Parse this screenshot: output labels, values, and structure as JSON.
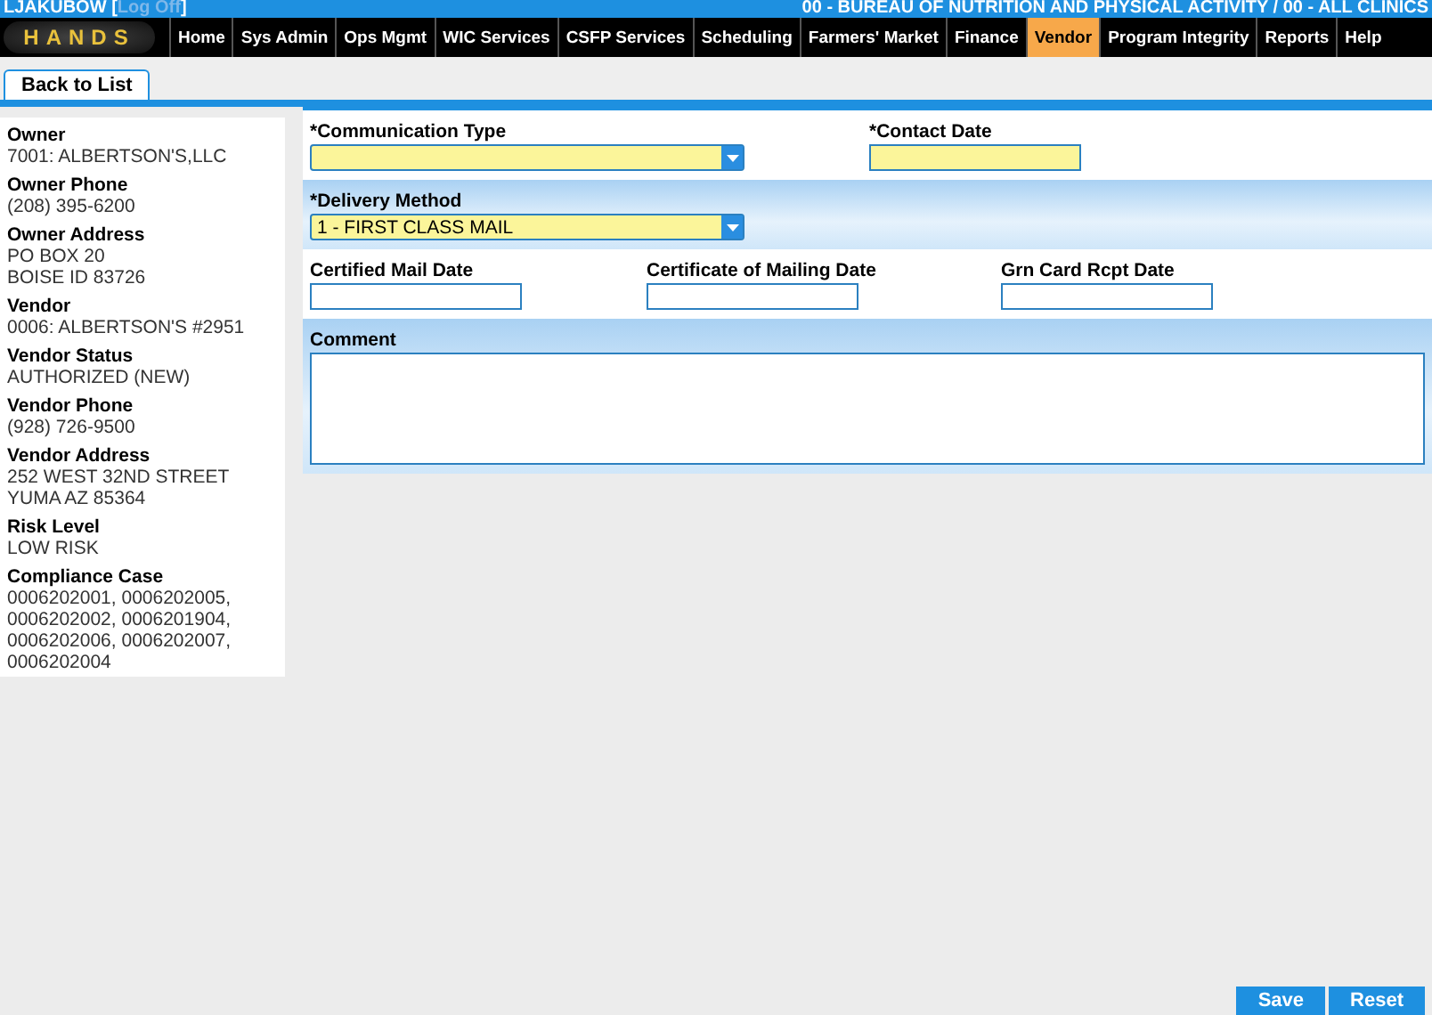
{
  "header": {
    "user": "LJAKUBOW",
    "open_bracket": "[",
    "log_off": "Log Off",
    "close_bracket": "]",
    "org": "00 - BUREAU OF NUTRITION AND PHYSICAL ACTIVITY / 00 - ALL CLINICS"
  },
  "logo": "HANDS",
  "menu": [
    {
      "label": "Home",
      "selected": false
    },
    {
      "label": "Sys Admin",
      "selected": false
    },
    {
      "label": "Ops Mgmt",
      "selected": false
    },
    {
      "label": "WIC Services",
      "selected": false
    },
    {
      "label": "CSFP Services",
      "selected": false
    },
    {
      "label": "Scheduling",
      "selected": false
    },
    {
      "label": "Farmers' Market",
      "selected": false
    },
    {
      "label": "Finance",
      "selected": false
    },
    {
      "label": "Vendor",
      "selected": true
    },
    {
      "label": "Program Integrity",
      "selected": false
    },
    {
      "label": "Reports",
      "selected": false
    },
    {
      "label": "Help",
      "selected": false
    }
  ],
  "tabs": [
    {
      "label": "Back to List",
      "selected": true
    }
  ],
  "sidebar": [
    {
      "label": "Owner",
      "lines": [
        "7001: ALBERTSON'S,LLC"
      ]
    },
    {
      "label": "Owner Phone",
      "lines": [
        "(208) 395-6200"
      ]
    },
    {
      "label": "Owner Address",
      "lines": [
        "PO BOX 20",
        "BOISE ID 83726"
      ]
    },
    {
      "label": "Vendor",
      "lines": [
        "0006: ALBERTSON'S #2951"
      ]
    },
    {
      "label": "Vendor Status",
      "lines": [
        "AUTHORIZED (NEW)"
      ]
    },
    {
      "label": "Vendor Phone",
      "lines": [
        "(928) 726-9500"
      ]
    },
    {
      "label": "Vendor Address",
      "lines": [
        "252 WEST 32ND STREET",
        "YUMA AZ 85364"
      ]
    },
    {
      "label": "Risk Level",
      "lines": [
        "LOW RISK"
      ]
    },
    {
      "label": "Compliance Case",
      "lines": [
        "0006202001, 0006202005, 0006202002, 0006201904, 0006202006, 0006202007, 0006202004"
      ]
    }
  ],
  "form": [
    {
      "shaded": false,
      "fields": [
        {
          "kind": "select",
          "label": "*Communication Type",
          "required": true
        },
        {
          "kind": "text",
          "label": "*Contact Date",
          "required": true
        }
      ]
    },
    {
      "shaded": true,
      "fields": [
        {
          "kind": "select",
          "label": "*Delivery Method",
          "value": "1 - FIRST CLASS MAIL",
          "required": true
        }
      ]
    },
    {
      "shaded": false,
      "fields": [
        {
          "kind": "text",
          "label": "Certified Mail Date",
          "required": false
        },
        {
          "kind": "text",
          "label": "Certificate of Mailing Date",
          "required": false
        },
        {
          "kind": "text",
          "label": "Grn Card Rcpt Date",
          "required": false
        }
      ]
    },
    {
      "shaded": true,
      "fields": [
        {
          "kind": "textarea",
          "label": "Comment",
          "required": false
        }
      ]
    }
  ],
  "buttons": [
    "Save",
    "Reset"
  ]
}
